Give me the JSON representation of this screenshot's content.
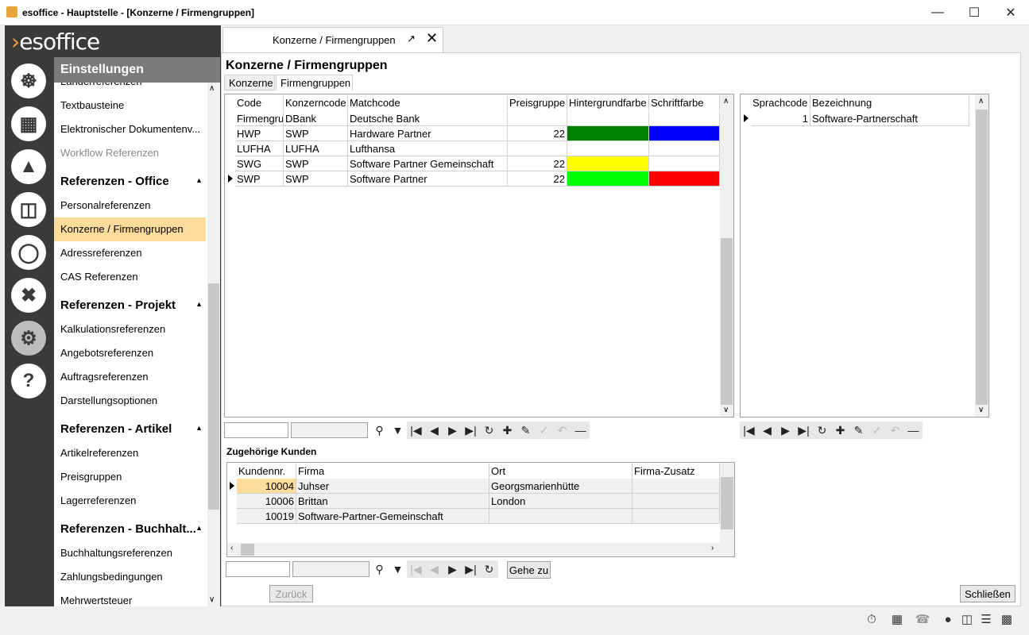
{
  "window": {
    "title": "esoffice - Hauptstelle - [Konzerne / Firmengruppen]"
  },
  "logo": {
    "text_a": "es",
    "text_b": "office"
  },
  "settings": {
    "header": "Einstellungen",
    "items": [
      {
        "label": "Länderreferenzen",
        "type": "item"
      },
      {
        "label": "Textbausteine",
        "type": "item"
      },
      {
        "label": "Elektronischer Dokumentenv...",
        "type": "item"
      },
      {
        "label": "Workflow Referenzen",
        "type": "item"
      },
      {
        "label": "Referenzen - Office",
        "type": "head"
      },
      {
        "label": "Personalreferenzen",
        "type": "item"
      },
      {
        "label": "Konzerne / Firmengruppen",
        "type": "item"
      },
      {
        "label": "Adressreferenzen",
        "type": "item"
      },
      {
        "label": "CAS Referenzen",
        "type": "item"
      },
      {
        "label": "Referenzen - Projekt",
        "type": "head"
      },
      {
        "label": "Kalkulationsreferenzen",
        "type": "item"
      },
      {
        "label": "Angebotsreferenzen",
        "type": "item"
      },
      {
        "label": "Auftragsreferenzen",
        "type": "item"
      },
      {
        "label": "Darstellungsoptionen",
        "type": "item"
      },
      {
        "label": "Referenzen - Artikel",
        "type": "head"
      },
      {
        "label": "Artikelreferenzen",
        "type": "item"
      },
      {
        "label": "Preisgruppen",
        "type": "item"
      },
      {
        "label": "Lagerreferenzen",
        "type": "item"
      },
      {
        "label": "Referenzen - Buchhalt...",
        "type": "head"
      },
      {
        "label": "Buchhaltungsreferenzen",
        "type": "item"
      },
      {
        "label": "Zahlungsbedingungen",
        "type": "item"
      },
      {
        "label": "Mehrwertsteuer",
        "type": "item"
      }
    ]
  },
  "doc_tab": {
    "label": "Konzerne / Firmengruppen"
  },
  "page": {
    "title": "Konzerne / Firmengruppen",
    "subtabs": [
      "Konzerne",
      "Firmengruppen"
    ]
  },
  "main_grid": {
    "columns": [
      "Code",
      "Konzerncode",
      "Matchcode",
      "Preisgruppe",
      "Hintergrundfarbe",
      "Schriftfarbe"
    ],
    "rows": [
      {
        "code": "Firmengru",
        "konzern": "DBank",
        "match": "Deutsche Bank",
        "preis": "",
        "bg": "#ffffff",
        "fg": "#ffffff"
      },
      {
        "code": "HWP",
        "konzern": "SWP",
        "match": "Hardware Partner",
        "preis": "22",
        "bg": "#008000",
        "fg": "#0000ff"
      },
      {
        "code": "LUFHA",
        "konzern": "LUFHA",
        "match": "Lufthansa",
        "preis": "",
        "bg": "#ffffff",
        "fg": "#ffffff"
      },
      {
        "code": "SWG",
        "konzern": "SWP",
        "match": "Software Partner Gemeinschaft",
        "preis": "22",
        "bg": "#ffff00",
        "fg": "#ffffff"
      },
      {
        "code": "SWP",
        "konzern": "SWP",
        "match": "Software Partner",
        "preis": "22",
        "bg": "#00ff00",
        "fg": "#ff0000"
      }
    ]
  },
  "lang_grid": {
    "columns": [
      "Sprachcode",
      "Bezeichnung"
    ],
    "rows": [
      {
        "code": "1",
        "name": "Software-Partnerschaft"
      }
    ]
  },
  "customers": {
    "label": "Zugehörige Kunden",
    "columns": [
      "Kundennr.",
      "Firma",
      "Ort",
      "Firma-Zusatz"
    ],
    "rows": [
      {
        "nr": "10004",
        "firma": "Juhser",
        "ort": "Georgsmarienhütte",
        "zusatz": ""
      },
      {
        "nr": "10006",
        "firma": "Brittan",
        "ort": "London",
        "zusatz": ""
      },
      {
        "nr": "10019",
        "firma": "Software-Partner-Gemeinschaft",
        "ort": "",
        "zusatz": ""
      }
    ],
    "goto_label": "Gehe zu"
  },
  "buttons": {
    "back": "Zurück",
    "close": "Schließen"
  }
}
